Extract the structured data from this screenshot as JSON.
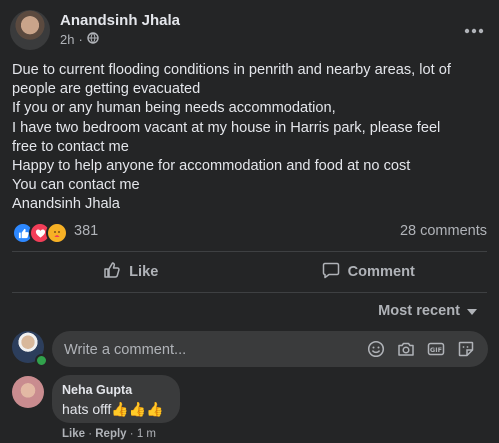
{
  "post": {
    "author": "Anandsinh Jhala",
    "time": "2h",
    "dot": "·",
    "body_lines": [
      "Due to current flooding conditions in penrith and nearby areas, lot of",
      "people are getting evacuated",
      "If you or any human being needs accommodation,",
      "I have two bedroom vacant at my house in Harris park,  please feel",
      "free to contact me",
      "Happy to help anyone for accommodation and food at no cost",
      "You can contact me",
      "Anandsinh Jhala"
    ]
  },
  "reactions": {
    "count": "381",
    "comments": "28 comments",
    "icons": [
      "like-icon",
      "love-icon",
      "care-icon"
    ],
    "colors": {
      "like": "#2d88ff",
      "love": "#f33e58",
      "care": "#f7b125"
    }
  },
  "actions": {
    "like": "Like",
    "comment": "Comment"
  },
  "sort": {
    "label": "Most recent"
  },
  "composer": {
    "placeholder": "Write a comment..."
  },
  "comment": {
    "author": "Neha Gupta",
    "text": "hats offf👍👍👍",
    "like": "Like",
    "reply": "Reply",
    "sep": " · ",
    "time": "1 m"
  }
}
